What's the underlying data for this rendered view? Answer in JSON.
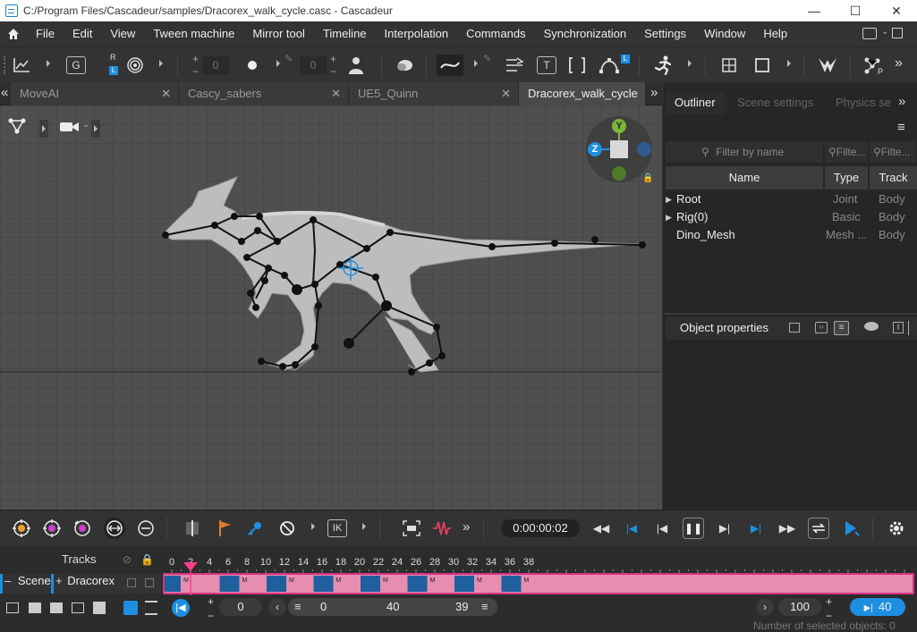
{
  "window": {
    "title": "C:/Program Files/Cascadeur/samples/Dracorex_walk_cycle.casc - Cascadeur",
    "minimize": "—",
    "maximize": "☐",
    "close": "✕"
  },
  "menu": [
    "File",
    "Edit",
    "View",
    "Tween machine",
    "Mirror tool",
    "Timeline",
    "Interpolation",
    "Commands",
    "Synchronization",
    "Settings",
    "Window",
    "Help"
  ],
  "toolbar": {
    "g_label": "G",
    "r_label": "R",
    "l_label": "L",
    "value_a": "0",
    "value_b": "0",
    "t_label": "T",
    "more": "»",
    "p_label": "P"
  },
  "tabs": [
    {
      "label": "MoveAI",
      "active": false
    },
    {
      "label": "Cascy_sabers",
      "active": false
    },
    {
      "label": "UE5_Quinn",
      "active": false
    },
    {
      "label": "Dracorex_walk_cycle",
      "active": true
    }
  ],
  "tabs_nav": {
    "left": "«",
    "right": "»"
  },
  "gizmo": {
    "y": "Y",
    "z": "Z"
  },
  "right_panel": {
    "tabs": [
      "Outliner",
      "Scene settings",
      "Physics se"
    ],
    "more": "»",
    "menu_icon": "≡",
    "filter_name": "Filter by name",
    "filter_type": "Filte...",
    "filter_track": "Filte...",
    "columns": {
      "name": "Name",
      "type": "Type",
      "track": "Track"
    },
    "rows": [
      {
        "name": "Root",
        "type": "Joint",
        "track": "Body",
        "expandable": true
      },
      {
        "name": "Rig(0)",
        "type": "Basic",
        "track": "Body",
        "expandable": true
      },
      {
        "name": "Dino_Mesh",
        "type": "Mesh ...",
        "track": "Body",
        "expandable": false
      }
    ],
    "object_properties": "Object properties"
  },
  "playback": {
    "time": "0:00:00:02",
    "more": "»",
    "ik": "IK"
  },
  "timeline": {
    "tracks_label": "Tracks",
    "scene_label": "Scene",
    "dracorex_label": "Dracorex",
    "scene_prefix": "–",
    "dracorex_prefix": "+",
    "ticks": [
      "0",
      "2",
      "4",
      "6",
      "8",
      "10",
      "12",
      "14",
      "16",
      "18",
      "20",
      "22",
      "24",
      "26",
      "28",
      "30",
      "32",
      "34",
      "36",
      "38"
    ],
    "current_frame": 2,
    "keyframes": [
      0,
      5,
      10,
      15,
      20,
      25,
      30,
      35
    ],
    "key_marker": "M"
  },
  "bottom": {
    "start": "0",
    "range_start": "0",
    "range_end": "40",
    "range_count": "39",
    "zoom": "100",
    "end_frame": "40",
    "status": "Number of selected objects: 0"
  },
  "colors": {
    "accent": "#1e8fe0",
    "keyframe": "#1f5f9e",
    "track": "#e78db0",
    "playhead": "#ff3d8b"
  }
}
